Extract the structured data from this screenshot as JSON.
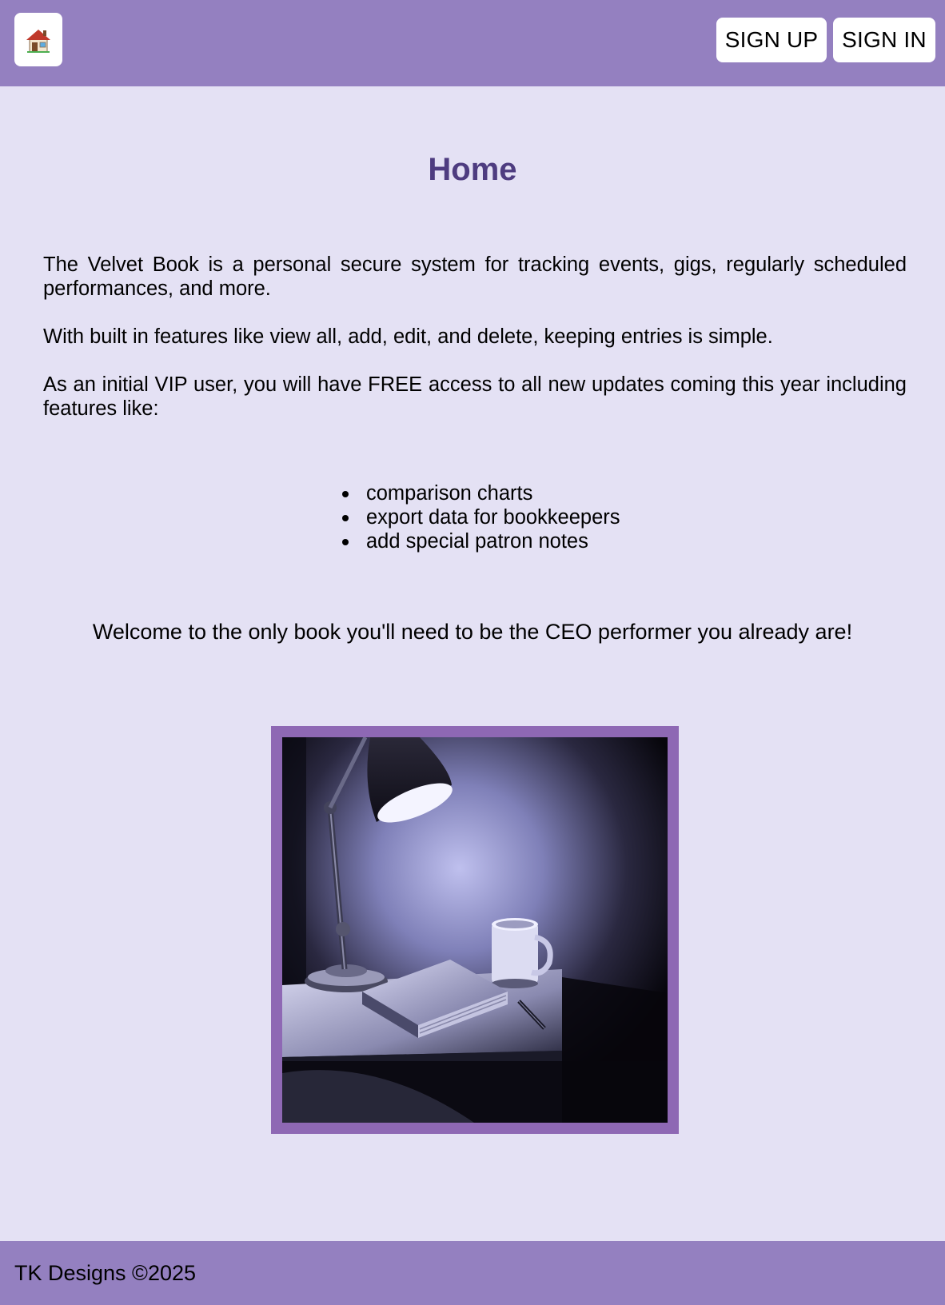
{
  "header": {
    "home_icon": "house-icon",
    "signup_label": "SIGN UP",
    "signin_label": "SIGN IN"
  },
  "main": {
    "title": "Home",
    "paragraphs": [
      "The Velvet Book is a personal secure system for tracking events, gigs, regularly scheduled performances, and more.",
      "With built in features like view all, add, edit, and delete, keeping entries is simple.",
      "As an initial VIP user, you will have FREE access to all new updates coming this year including features like:"
    ],
    "features": [
      "comparison charts",
      "export data for bookkeepers",
      "add special patron notes"
    ],
    "welcome": "Welcome to the only book you'll need to be the CEO performer you already are!"
  },
  "footer": {
    "text": "TK Designs ©2025"
  },
  "colors": {
    "header_bg": "#9480c0",
    "page_bg": "#e4e1f4",
    "title": "#4e3c80",
    "frame": "#8e68b4"
  }
}
